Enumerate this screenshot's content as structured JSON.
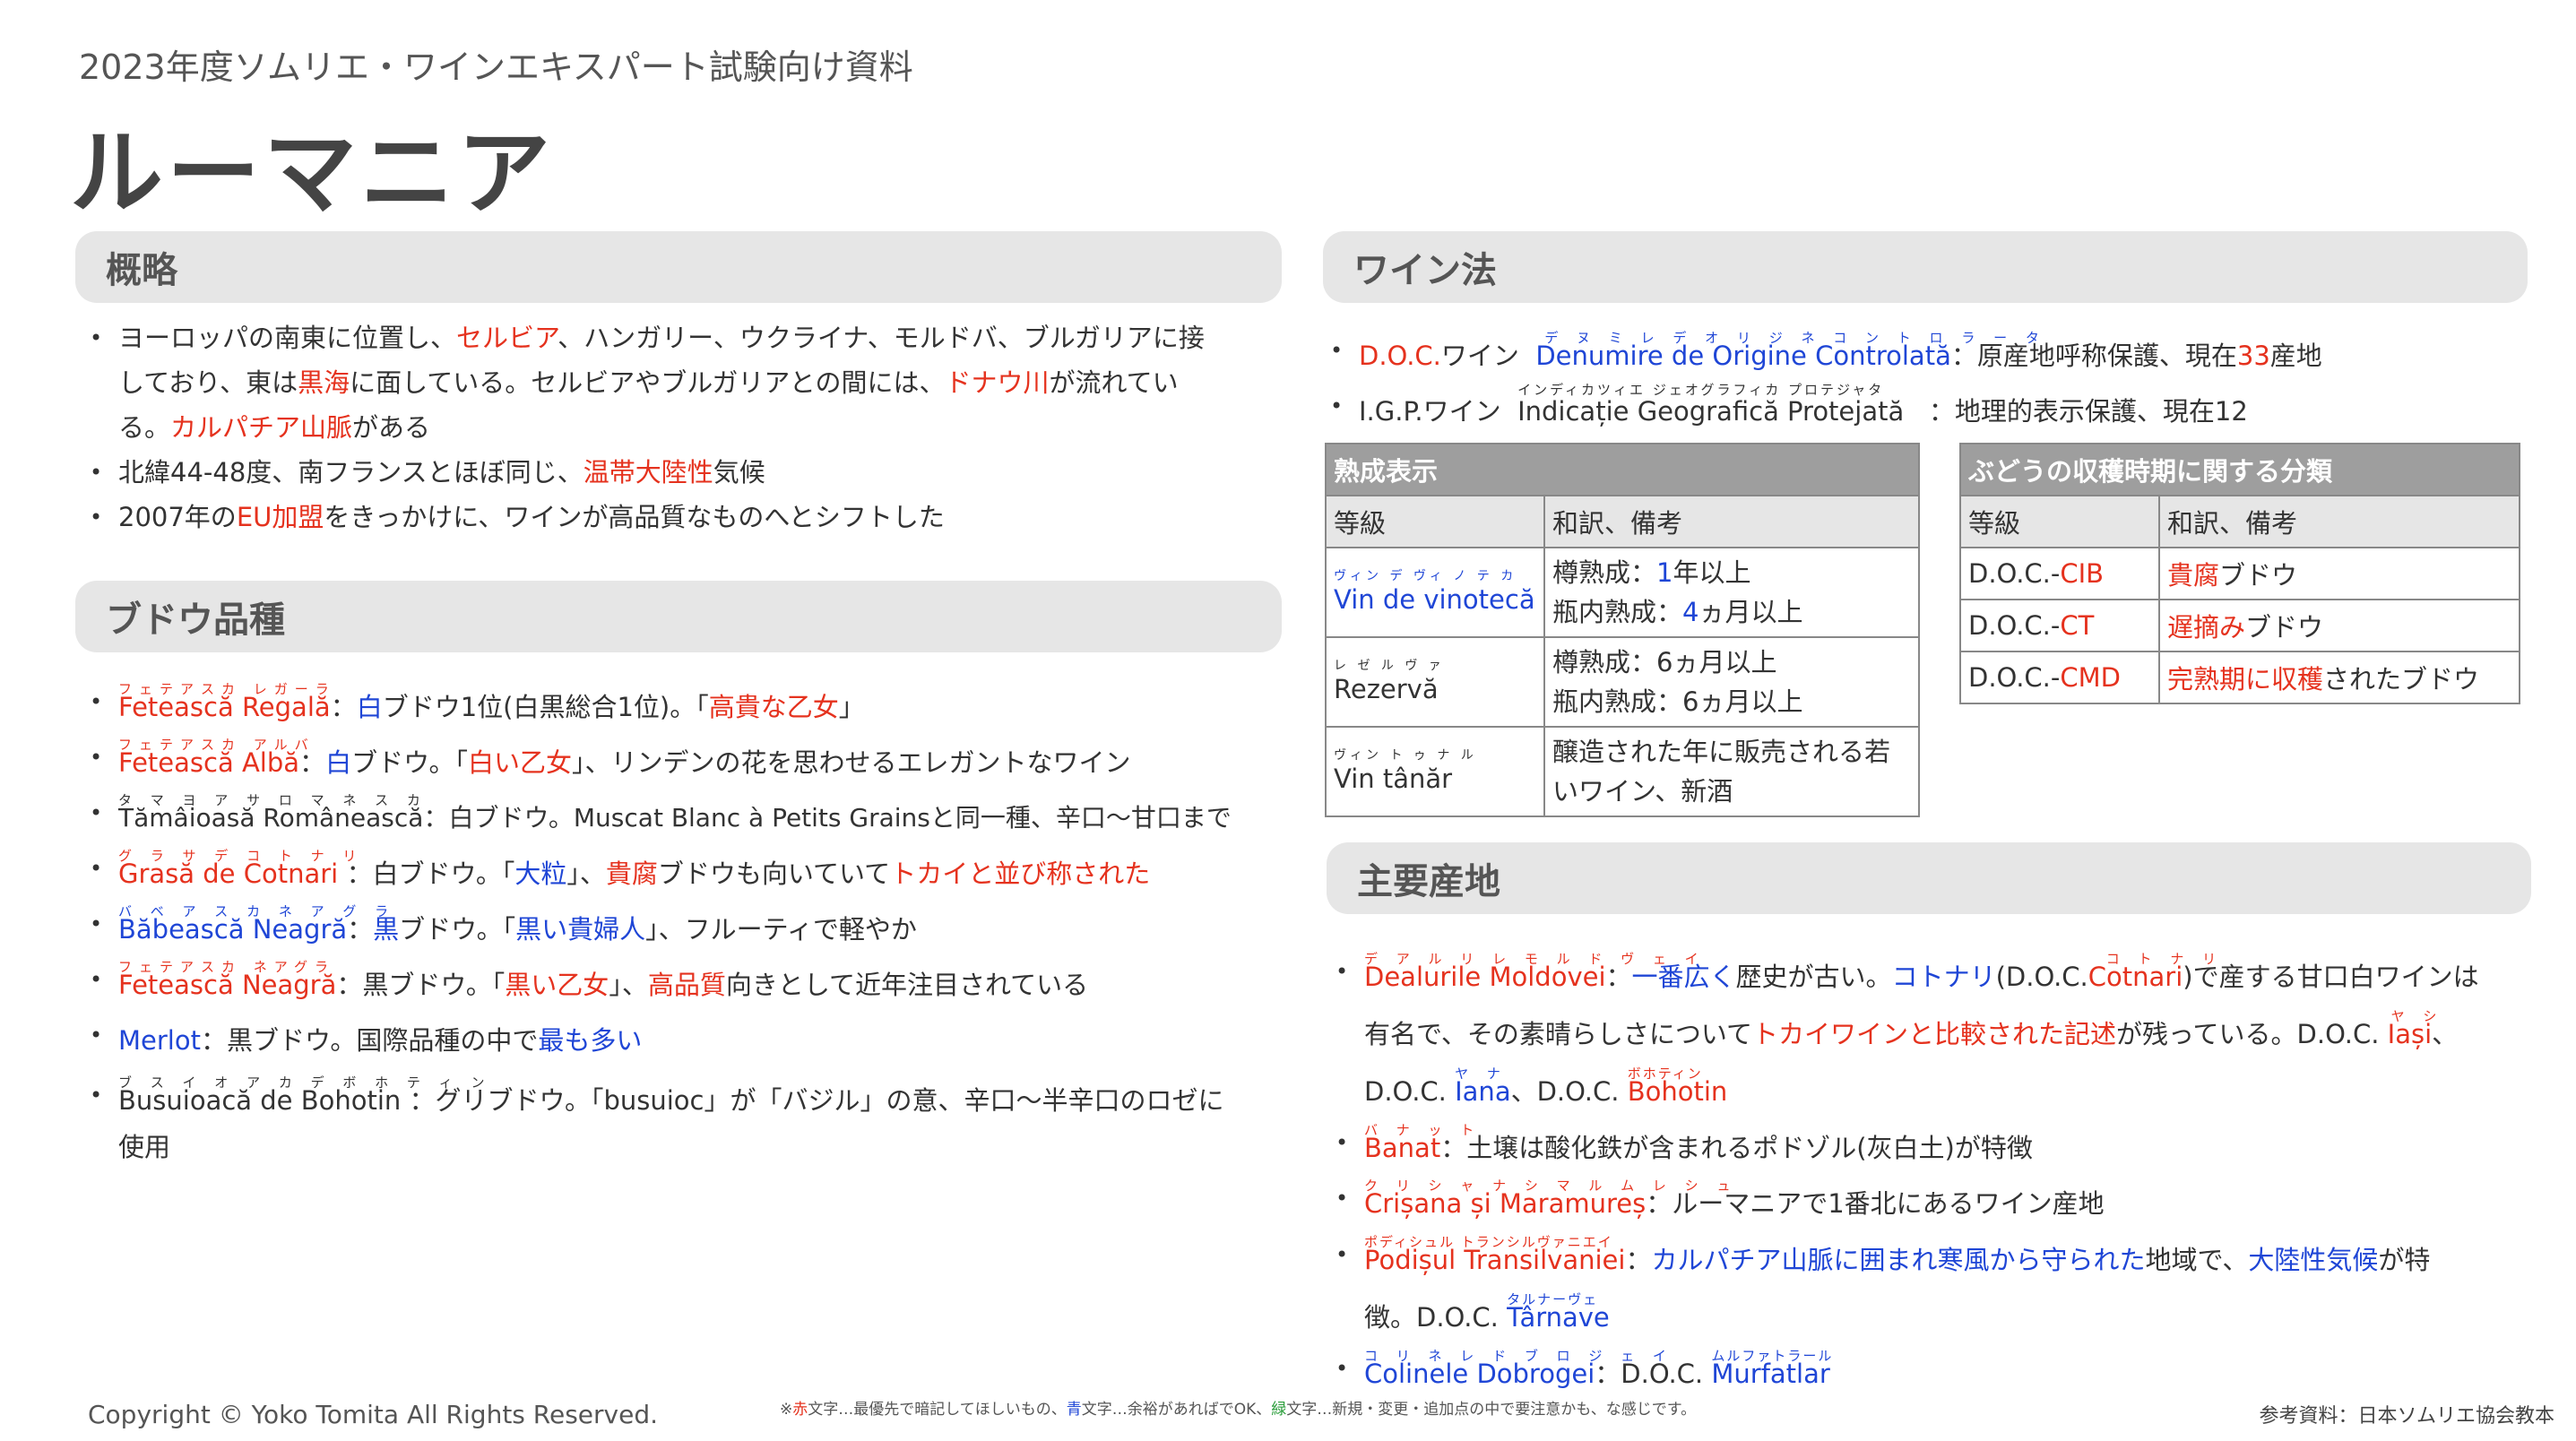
{
  "header": {
    "subtitle": "2023年度ソムリエ・ワインエキスパート試験向け資料",
    "title": "ルーマニア"
  },
  "sections": {
    "overview": "概略",
    "grapes": "ブドウ品種",
    "law": "ワイン法",
    "regions": "主要産地"
  },
  "overview": {
    "b1": [
      "ヨーロッパの南東に位置し、",
      "セルビア",
      "、ハンガリー、ウクライナ、モルドバ、ブルガリアに接",
      "しており、東は",
      "黒海",
      "に面している。セルビアやブルガリアとの間には、",
      "ドナウ川",
      "が流れてい",
      "る。",
      "カルパチア山脈",
      "がある"
    ],
    "b2": [
      "北緯44-48度、南フランスとほぼ同じ、",
      "温帯大陸性",
      "気候"
    ],
    "b3": [
      "2007年の",
      "EU加盟",
      "をきっかけに、ワインが高品質なものへとシフトした"
    ]
  },
  "grapes": [
    {
      "ruby": "フェテアスカ レガーラ",
      "name": "Fetească Regală",
      "parts": [
        "：",
        "白",
        "ブドウ1位(白黒総合1位)。「",
        "高貴な乙女",
        "」"
      ]
    },
    {
      "ruby": "フェテアスカ アルバ",
      "name": "Fetească Albă",
      "parts": [
        "：",
        "白",
        "ブドウ。「",
        "白い乙女",
        "」、リンデンの花を思わせるエレガントなワイン"
      ]
    },
    {
      "ruby": "タ マ ヨ ア サ  ロ マ ネ ス カ",
      "name": "Tămâioasă Românească",
      "parts": [
        "：白ブドウ。Muscat Blanc à Petits Grainsと同一種、辛口〜甘口まで"
      ]
    },
    {
      "ruby": "グ ラ サ  デ  コ ト ナ リ",
      "name": "Grasă de Cotnari",
      "parts": [
        " ：白ブドウ。「",
        "大粒",
        "」、",
        "貴腐",
        "ブドウも向いていて",
        "トカイと並び称された"
      ]
    },
    {
      "ruby": "バ ベ ア ス カ  ネ ア グ ラ",
      "name": "Băbească Neagră",
      "parts": [
        "：",
        "黒",
        "ブドウ。「",
        "黒い貴婦人",
        "」、フルーティで軽やか"
      ]
    },
    {
      "ruby": "フェテアスカ  ネアグラ",
      "name": "Fetească Neagră",
      "parts": [
        "：黒ブドウ。「",
        "黒い乙女",
        "」、",
        "高品質",
        "向きとして近年注目されている"
      ]
    },
    {
      "ruby": "",
      "name": "Merlot",
      "parts": [
        "：黒ブドウ。国際品種の中で",
        "最も多い"
      ]
    },
    {
      "ruby": "ブ ス イ オ ア カ  デ  ボ ホ テ ィ ン",
      "name": "Busuioacă de Bohotin",
      "parts": [
        " ：グリブドウ。「busuioc」が「バジル」の意、辛口〜半辛口のロゼに",
        "使用"
      ]
    }
  ],
  "law": {
    "doc": {
      "label": "D.O.C.",
      "suffix": "ワイン",
      "ruby": "デ ヌ ミ レ  デ  オ リ ジ ネ  コ ン ト ロ ラ ー タ",
      "name": "Denumire de Origine Controlată",
      "desc": "：原産地呼称保護、現在",
      "num": "33",
      "tail": "産地"
    },
    "igp": {
      "label": "I.G.P.ワイン",
      "ruby": "インディカツィエ ジェオグラフィカ プロテジャタ",
      "name": "Indicație Geografică Protejată",
      "desc": "：地理的表示保護、現在12"
    }
  },
  "aging": {
    "caption": "熟成表示",
    "col1": "等級",
    "col2": "和訳、備考",
    "rows": [
      {
        "ruby": "ヴィン デ ヴィ ノ テ カ",
        "name": "Vin de vinotecă",
        "l1a": "樽熟成：",
        "l1b": "1",
        "l1c": "年以上",
        "l2a": "瓶内熟成：",
        "l2b": "4",
        "l2c": "ヵ月以上"
      },
      {
        "ruby": "レ ゼ ル ヴ ァ",
        "name": "Rezervă",
        "l1a": "樽熟成：6ヵ月以上",
        "l2a": "瓶内熟成：6ヵ月以上"
      },
      {
        "ruby": "ヴィン  ト ゥ ナ ル",
        "name": "Vin tânăr",
        "l1a": "醸造された年に販売される若",
        "l2a": "いワイン、新酒"
      }
    ]
  },
  "harvest": {
    "caption": "ぶどうの収穫時期に関する分類",
    "col1": "等級",
    "col2": "和訳、備考",
    "rows": [
      {
        "pre": "D.O.C.-",
        "code": "CIB",
        "red": "貴腐",
        "rest": "ブドウ"
      },
      {
        "pre": "D.O.C.-",
        "code": "CT",
        "red": "遅摘み",
        "rest": "ブドウ"
      },
      {
        "pre": "D.O.C.-",
        "code": "CMD",
        "red": "完熟期に収穫",
        "rest": "されたブドウ"
      }
    ]
  },
  "regions": {
    "r1": {
      "ruby": "デ ア ル リ レ  モ ル ド ヴ ェ イ",
      "name": "Dealurile Moldovei",
      "a": "：",
      "b": "一番広く",
      "c": "歴史が古い。",
      "d": "コトナリ",
      "e": "(D.O.C.",
      "f": "Cotnari",
      "g": ")で産する甘口白ワインは",
      "h": "有名で、その素晴らしさについて",
      "i": "トカイワインと比較された記述",
      "j": "が残っている。D.O.C. ",
      "k": "Iași",
      "l": "、",
      "m": "D.O.C. ",
      "n": "Iana",
      "o": "、D.O.C. ",
      "p": "Bohotin",
      "ruby_cotnari": "コ ト ナ リ",
      "ruby_iasi": "ヤ シ",
      "ruby_iana": "ヤ ナ",
      "ruby_bohotin": "ボホティン"
    },
    "r2": {
      "ruby": "バ ナ ッ ト",
      "name": "Banat",
      "desc": "：土壌は酸化鉄が含まれるポドゾル(灰白土)が特徴"
    },
    "r3": {
      "ruby": "ク リ シ ャ ナ  シ  マ ル ム レ シ ュ",
      "name": "Crișana și Maramureș",
      "desc": "：ルーマニアで1番北にあるワイン産地"
    },
    "r4": {
      "ruby": "ポディシュル トランシルヴァニエイ",
      "name": "Podișul Transilvaniei",
      "a": "：",
      "b": "カルパチア山脈に囲まれ寒風から守られた",
      "c": "地域で、",
      "d": "大陸性気候",
      "e": "が特",
      "f": "徴。D.O.C. ",
      "g": "Târnave",
      "ruby_tarnave": "タルナーヴェ"
    },
    "r5": {
      "ruby": "コ  リ  ネ  レ  ド ブ ロ ジ ェ イ",
      "name": "Colinele Dobrogei",
      "a": "：D.O.C. ",
      "b": "Murfatlar",
      "ruby_murfatlar": "ムルファトラール"
    }
  },
  "footer": {
    "copyright": "Copyright © Yoko Tomita All Rights Reserved.",
    "legend": [
      "※",
      "赤",
      "文字…最優先で暗記してほしいもの、",
      "青",
      "文字…余裕があればでOK、",
      "緑",
      "文字…新規・変更・追加点の中で要注意かも、な感じです。"
    ],
    "reference": "参考資料：日本ソムリエ協会教本"
  },
  "colors": {
    "red": "#e5321e",
    "blue": "#1f46d6",
    "green": "#2a9d3a",
    "band": "#e6e6e6"
  }
}
